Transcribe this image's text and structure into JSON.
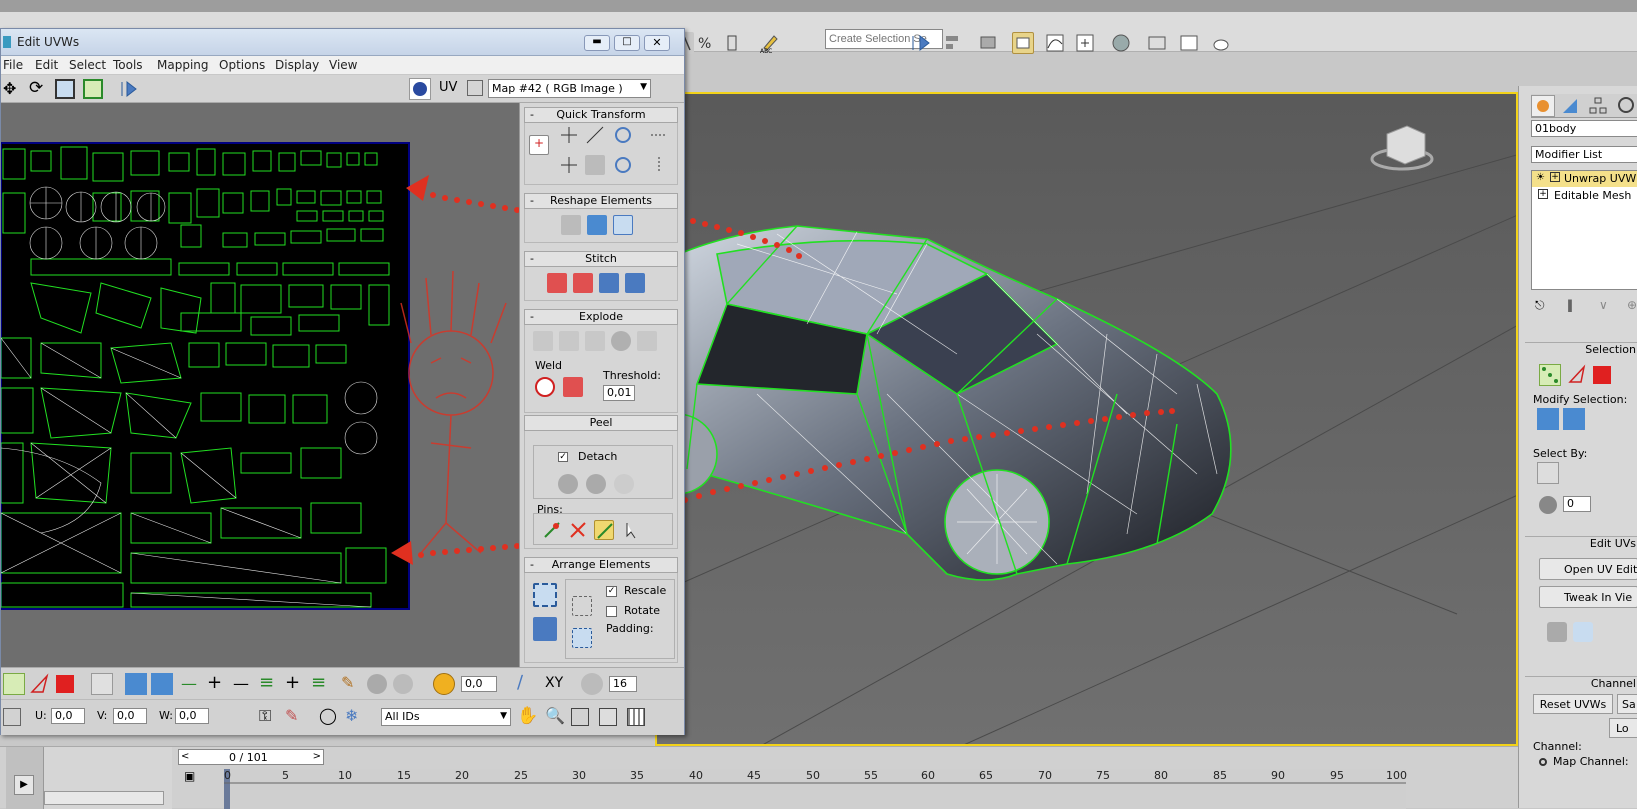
{
  "toolbar": {
    "selection_set_placeholder": "Create Selection Se",
    "abc_label": "ABC"
  },
  "uv_editor": {
    "title": "Edit UVWs",
    "menu": [
      "File",
      "Edit",
      "Select",
      "Tools",
      "Mapping",
      "Options",
      "Display",
      "View"
    ],
    "uv_label": "UV",
    "map_dropdown": "Map #42  ( RGB Image )",
    "rollouts": {
      "quick_transform": "Quick Transform",
      "reshape_elements": "Reshape Elements",
      "stitch": "Stitch",
      "explode": "Explode",
      "weld_label": "Weld",
      "threshold_label": "Threshold:",
      "threshold_value": "0,01",
      "peel": "Peel",
      "detach_label": "Detach",
      "pins_label": "Pins:",
      "arrange_elements": "Arrange Elements",
      "rescale_label": "Rescale",
      "rotate_label": "Rotate",
      "padding_label": "Padding:",
      "collapse_mark": "-"
    },
    "bottom": {
      "soft_value": "0,0",
      "xy_label": "XY",
      "size_value": "16",
      "u_label": "U:",
      "u_value": "0,0",
      "v_label": "V:",
      "v_value": "0,0",
      "w_label": "W:",
      "w_value": "0,0",
      "ids_dropdown": "All IDs"
    }
  },
  "command_panel": {
    "object_name": "01body",
    "modifier_list": "Modifier List",
    "stack": [
      "Unwrap UVW",
      "Editable Mesh"
    ],
    "selection_header": "Selection",
    "modify_selection_label": "Modify Selection:",
    "select_by_label": "Select By:",
    "select_by_value": "0",
    "edit_uvs_header": "Edit UVs",
    "open_uv_editor": "Open UV Editor",
    "tweak_in_view": "Tweak In Vie",
    "channel_header": "Channel",
    "reset_uvws": "Reset UVWs",
    "save_short": "Sa",
    "load_short": "Lo",
    "channel_label": "Channel:",
    "map_channel_label": "Map Channel:"
  },
  "timeline": {
    "frame_counter": "0 / 101",
    "ticks": [
      "0",
      "5",
      "10",
      "15",
      "20",
      "25",
      "30",
      "35",
      "40",
      "45",
      "50",
      "55",
      "60",
      "65",
      "70",
      "75",
      "80",
      "85",
      "90",
      "95",
      "100"
    ]
  },
  "colors": {
    "wire_green": "#22e022",
    "viewport_border": "#f2d21a",
    "annotation_red": "#e03020"
  }
}
